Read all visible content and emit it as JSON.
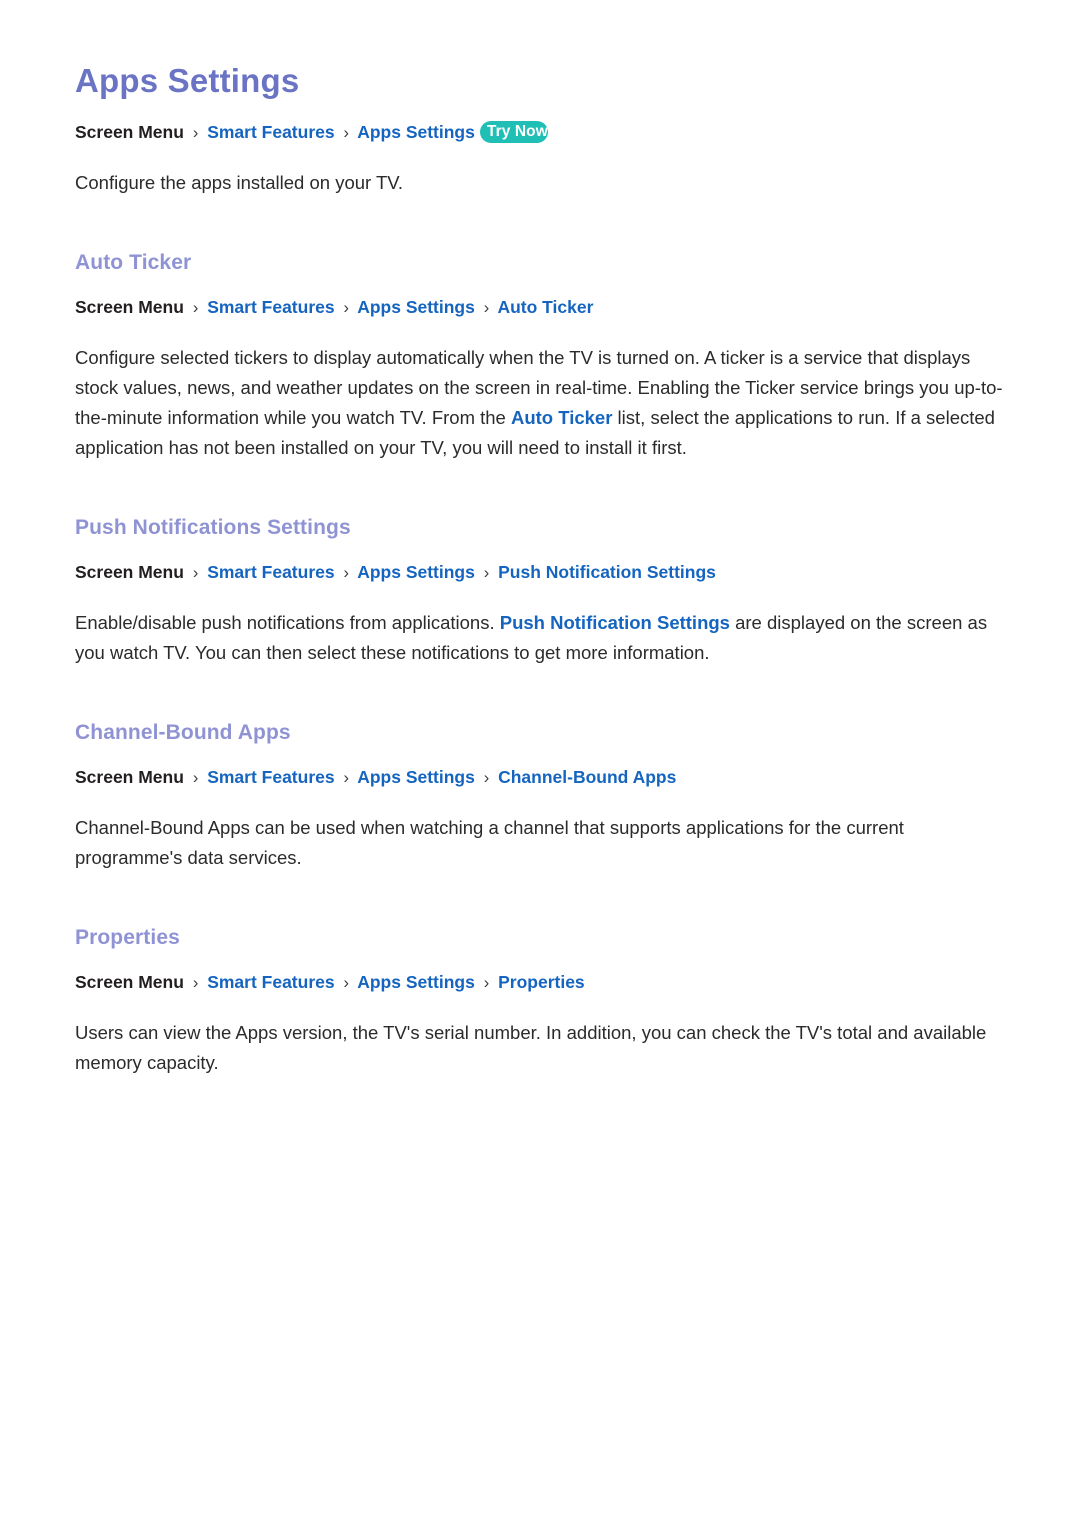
{
  "document": {
    "title": "Apps Settings",
    "breadcrumb": {
      "root": "Screen Menu",
      "separator": "›",
      "links": [
        "Smart Features",
        "Apps Settings"
      ],
      "badge": "Try Now"
    },
    "intro": "Configure the apps installed on your TV."
  },
  "colors": {
    "page_title": "#6b74c4",
    "section_heading": "#8f93d4",
    "link": "#1565c0",
    "badge_background": "#1fbfb6",
    "badge_text": "#ffffff",
    "body_text": "#2b2b2b",
    "background": "#ffffff"
  },
  "sections": [
    {
      "heading": "Auto Ticker",
      "breadcrumb": {
        "root": "Screen Menu",
        "links": [
          "Smart Features",
          "Apps Settings",
          "Auto Ticker"
        ]
      },
      "body_part_1": "Configure selected tickers to display automatically when the TV is turned on. A ticker is a service that displays stock values, news, and weather updates on the screen in real-time. Enabling the Ticker service brings you up-to-the-minute information while you watch TV. From the ",
      "body_link": "Auto Ticker",
      "body_part_2": " list, select the applications to run. If a selected application has not been installed on your TV, you will need to install it first."
    },
    {
      "heading": "Push Notifications Settings",
      "breadcrumb": {
        "root": "Screen Menu",
        "links": [
          "Smart Features",
          "Apps Settings",
          "Push Notification Settings"
        ]
      },
      "body_part_1": "Enable/disable push notifications from applications. ",
      "body_link": "Push Notification Settings",
      "body_part_2": " are displayed on the screen as you watch TV. You can then select these notifications to get more information."
    },
    {
      "heading": "Channel-Bound Apps",
      "breadcrumb": {
        "root": "Screen Menu",
        "links": [
          "Smart Features",
          "Apps Settings",
          "Channel-Bound Apps"
        ]
      },
      "body_part_1": "Channel-Bound Apps can be used when watching a channel that supports applications for the current programme's data services.",
      "body_link": "",
      "body_part_2": ""
    },
    {
      "heading": "Properties",
      "breadcrumb": {
        "root": "Screen Menu",
        "links": [
          "Smart Features",
          "Apps Settings",
          "Properties"
        ]
      },
      "body_part_1": "Users can view the Apps version, the TV's serial number. In addition, you can check the TV's total and available memory capacity.",
      "body_link": "",
      "body_part_2": ""
    }
  ]
}
